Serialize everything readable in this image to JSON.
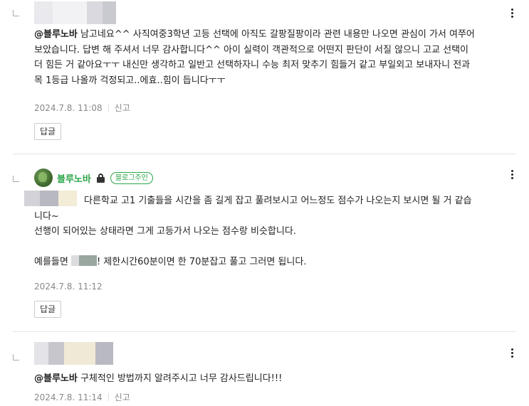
{
  "comments": [
    {
      "mention": "@블루노바",
      "text_lines": [
        " 남고네요^^ 사직여중3학년 고등 선택에 아직도 갈팡질팡이라 관련 내용만 나오면 관심이 가서 여쭈어",
        "보았습니다. 답변 해 주셔서 너무 감사합니다^^ 아이 실력이 객관적으로 어떤지 판단이 서질 않으니 고교 선택이",
        "더 힘든 거 같아요ㅜㅜ 내신만 생각하고 일반고 선택하자니 수능 최저 맞추기 힘들거 같고 부일외고 보내자니 전과",
        "목 1등급 나올까 걱정되고..에효..힘이 듭니다ㅜㅜ"
      ],
      "date": "2024.7.8. 11:08",
      "report": "신고",
      "reply_label": "답글"
    },
    {
      "nickname": "블루노바",
      "badge": "블로그주인",
      "text_lines": [
        "다른학교 고1 기출들을 시간을 좀 길게 잡고 풀려보시고 어느정도 점수가 나오는지 보시면 될 거 같습",
        "니다~",
        "선행이 되어있는 상태라면 그게 고등가서 나오는 점수랑 비슷합니다.",
        "",
        "예를들면 ",
        "! 제한시간60분이면 한 70분잡고 풀고 그러면 됩니다."
      ],
      "date": "2024.7.8. 11:12",
      "reply_label": "답글"
    },
    {
      "mention": "@블루노바",
      "text": " 구체적인 방법까지 알려주시고 너무 감사드립니다!!!",
      "date": "2024.7.8. 11:14",
      "report": "신고"
    }
  ],
  "colors": {
    "blog_owner_green": "#2da64a",
    "meta_gray": "#888888",
    "divider": "#e5e5e5"
  },
  "icons": {
    "more": "more-vertical-icon",
    "lock": "lock-icon",
    "reply_indent": "reply-indent-icon"
  }
}
